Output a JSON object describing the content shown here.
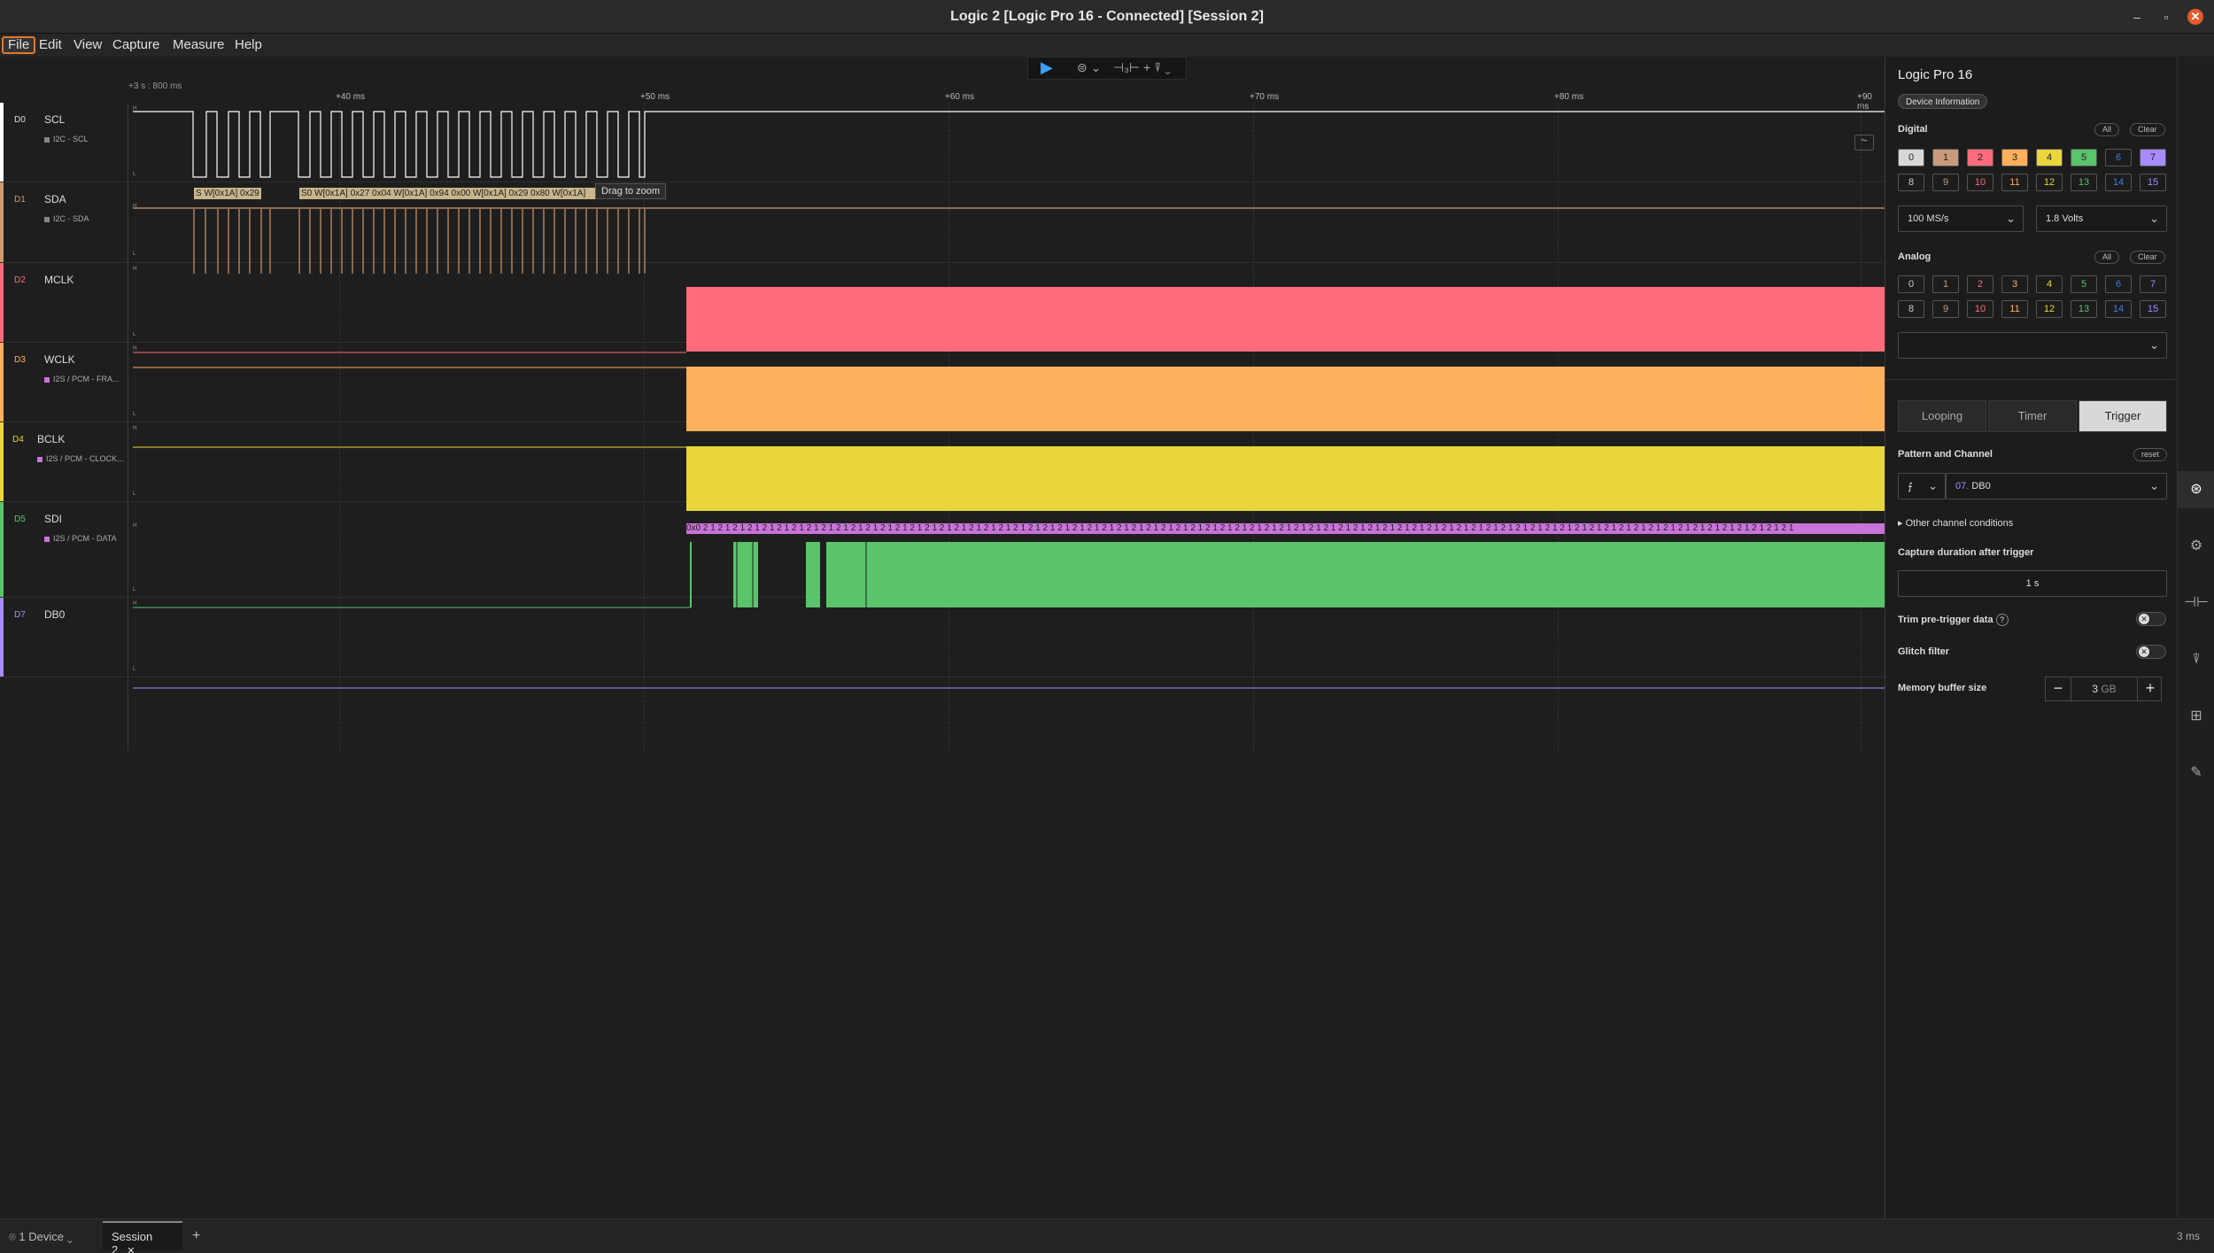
{
  "window": {
    "title": "Logic 2 [Logic Pro 16 - Connected] [Session 2]",
    "minimize": "–",
    "maximize": "▫",
    "close": "✕"
  },
  "menu": {
    "file": "File",
    "edit": "Edit",
    "view": "View",
    "capture": "Capture",
    "measure": "Measure",
    "help": "Help"
  },
  "toolbar": {
    "play_icon": "play-icon",
    "glyph_1": "⊜ ⌄",
    "glyph_2": "⊣₃⊢ +",
    "glyph_3": "⍒ ⌄"
  },
  "timeline": {
    "prefix": "+3 s : 800 ms",
    "ticks": [
      "+40 ms",
      "+50 ms",
      "+60 ms",
      "+70 ms",
      "+80 ms",
      "+90 ms"
    ]
  },
  "channels": [
    {
      "id": "D0",
      "name": "SCL",
      "analyzer": "I2C - SCL",
      "color": "#ffffff"
    },
    {
      "id": "D1",
      "name": "SDA",
      "analyzer": "I2C - SDA",
      "color": "#d09a70"
    },
    {
      "id": "D2",
      "name": "MCLK",
      "analyzer": "",
      "color": "#ff6b7a"
    },
    {
      "id": "D3",
      "name": "WCLK",
      "analyzer": "I2S / PCM - FRA...",
      "color": "#ffb05c"
    },
    {
      "id": "D4",
      "name": "BCLK",
      "analyzer": "I2S / PCM - CLOCK...",
      "color": "#e8d63a"
    },
    {
      "id": "D5",
      "name": "SDI",
      "analyzer": "I2S / PCM - DATA",
      "color": "#59c46a"
    },
    {
      "id": "D7",
      "name": "DB0",
      "analyzer": "",
      "color": "#a68cff"
    }
  ],
  "level_labels": {
    "high": "H",
    "low": "L"
  },
  "i2c_labels": {
    "first_start": "S",
    "first": "W[0x1A] 0x29",
    "second_start": "S0",
    "second": "W[0x1A] 0x27 0x04 W[0x1A] 0x94 0x00 W[0x1A] 0x29 0x80 W[0x1A]"
  },
  "tooltip": "Drag to zoom",
  "i2s_strip": {
    "start": "0x0",
    "pattern": "2 1 2 1 2 1 2 1 2 1 2 1 2 1 2 1 2 1 2 1 2 1 2 1 2 1 2 1 2 1 2 1 2 1 2 1 2 1 2 1 2 1 2 1 2 1 2 1 2 1 2 1 2 1 2 1 2 1 2 1 2 1 2 1 2 1 2 1 2 1 2 1 2 1 2 1 2 1 2 1 2 1 2 1 2 1 2 1 2 1 2 1 2 1 2 1 2 1 2 1 2 1 2 1 2 1 2 1 2 1 2 1 2 1 2 1 2 1 2 1 2 1 2 1 2 1 2 1 2 1 2 1 2 1 2 1 2 1 2 1 2 1 2 1 2 1 2 1"
  },
  "panel": {
    "device": "Logic Pro 16",
    "device_info": "Device Information",
    "digital_label": "Digital",
    "analog_label": "Analog",
    "all": "All",
    "clear": "Clear",
    "digital_channels": [
      "0",
      "1",
      "2",
      "3",
      "4",
      "5",
      "6",
      "7",
      "8",
      "9",
      "10",
      "11",
      "12",
      "13",
      "14",
      "15"
    ],
    "analog_channels": [
      "0",
      "1",
      "2",
      "3",
      "4",
      "5",
      "6",
      "7",
      "8",
      "9",
      "10",
      "11",
      "12",
      "13",
      "14",
      "15"
    ],
    "sample_rate": "100 MS/s",
    "voltage": "1.8 Volts",
    "analog_rate": "",
    "modes": {
      "looping": "Looping",
      "timer": "Timer",
      "trigger": "Trigger"
    },
    "pattern_label": "Pattern and Channel",
    "reset": "reset",
    "trigger_edge": "⨍",
    "trigger_channel_num": "07.",
    "trigger_channel_name": "DB0",
    "other_conditions": "Other channel conditions",
    "capture_after_label": "Capture duration after trigger",
    "capture_after_value": "1 s",
    "trim_label": "Trim pre-trigger data",
    "glitch_label": "Glitch filter",
    "memory_label": "Memory buffer size",
    "memory_value": "3",
    "memory_unit": "GB"
  },
  "status": {
    "devices": "1 Device",
    "session": "Session 2",
    "right": "3 ms"
  },
  "colors": {
    "accent": "#e07b2e",
    "play": "#3aa0ff",
    "digital_boxes": [
      "#d8d8d8",
      "#c99b7c",
      "#ff6b7a",
      "#ffb05c",
      "#e8d63a",
      "#59c46a",
      "#3e7fd8",
      "#a68cff"
    ]
  }
}
